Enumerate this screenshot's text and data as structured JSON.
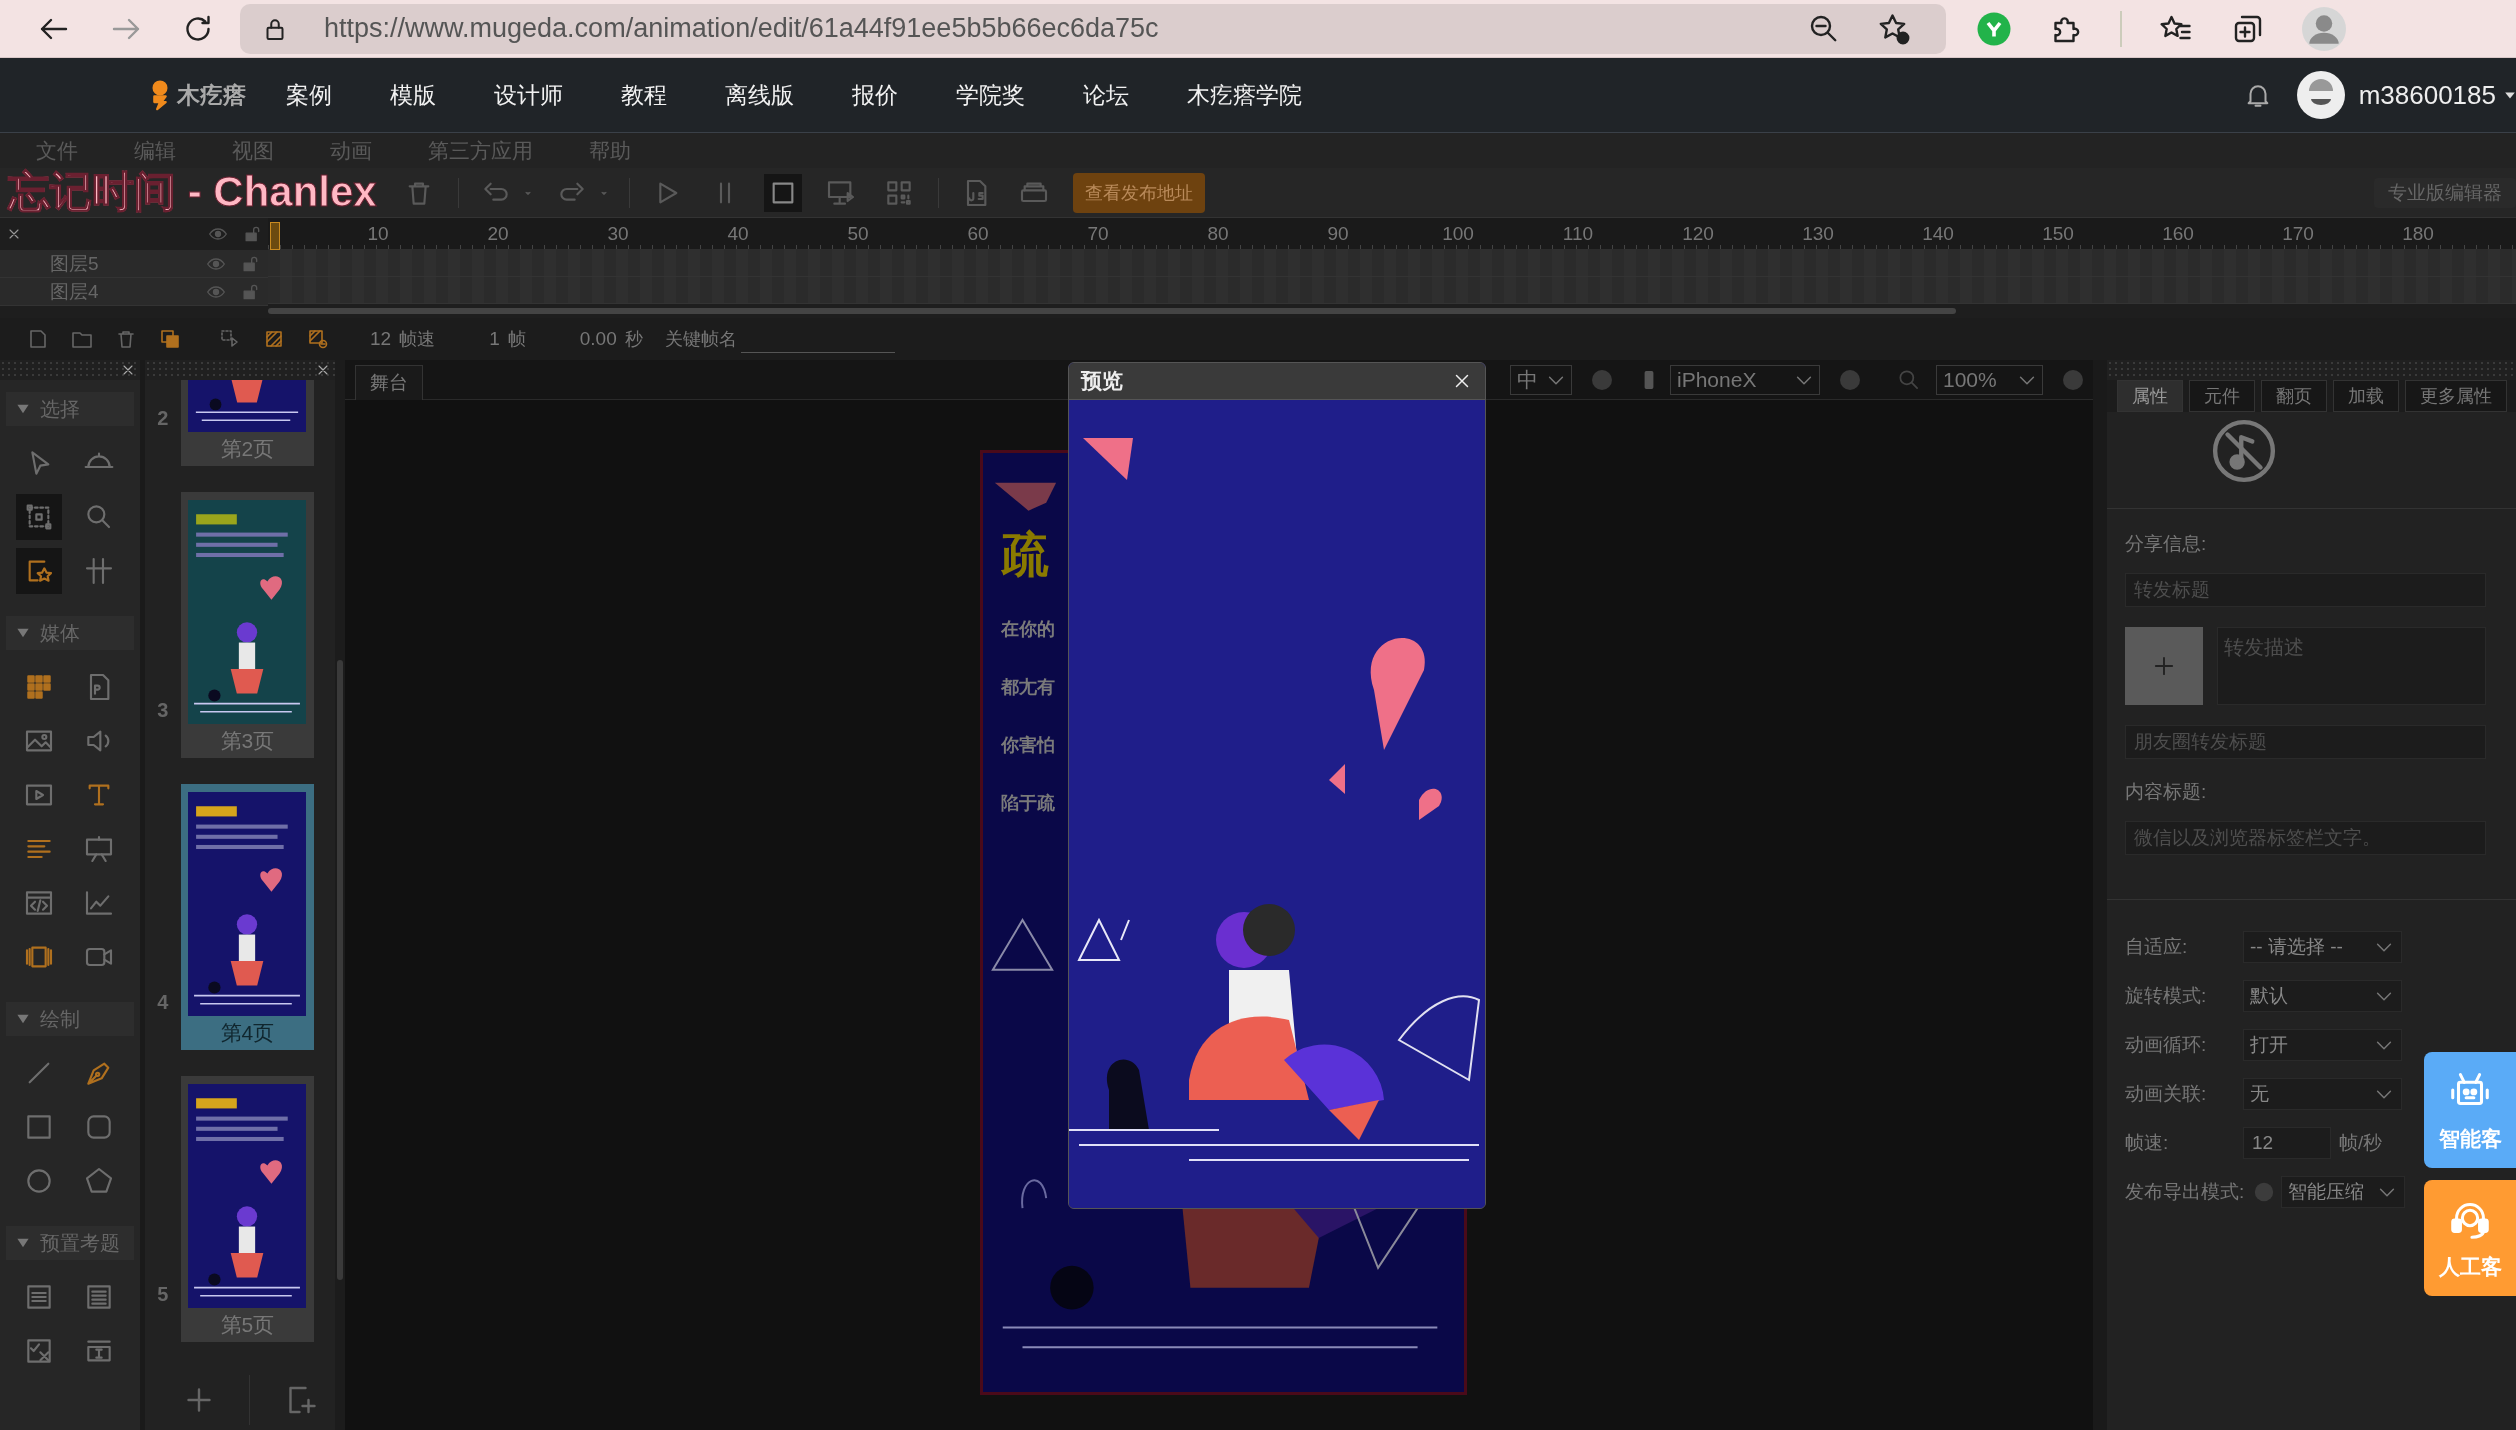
{
  "browser": {
    "url": "https://www.mugeda.com/animation/edit/61a44f91ee5b5b66ec6da75c"
  },
  "nav": {
    "logo": "木疙瘩",
    "items": [
      "案例",
      "模版",
      "设计师",
      "教程",
      "离线版",
      "报价",
      "学院奖",
      "论坛",
      "木疙瘩学院"
    ],
    "user": "m38600185"
  },
  "menu": [
    "文件",
    "编辑",
    "视图",
    "动画",
    "第三方应用",
    "帮助"
  ],
  "lyrics_overlay": "忘记时间 - Chanlex",
  "toolbar": {
    "publish_button": "查看发布地址",
    "pro_editor_button": "专业版编辑器"
  },
  "timeline": {
    "ticks": [
      "10",
      "20",
      "30",
      "40",
      "50",
      "60",
      "70",
      "80",
      "90",
      "100",
      "110",
      "120",
      "130",
      "140",
      "150",
      "160",
      "170",
      "180"
    ],
    "layers": [
      {
        "name": "图层5"
      },
      {
        "name": "图层4"
      }
    ],
    "fps": "12",
    "fps_label": "帧速",
    "frame": "1",
    "frame_label": "帧",
    "time": "0.00",
    "time_label": "秒",
    "keyframe_label": "关键帧名"
  },
  "tool_groups": [
    {
      "title": "选择",
      "expanded": true,
      "tools": [
        {
          "selected": false
        },
        {
          "selected": false
        },
        {
          "selected": true
        },
        {
          "selected": false
        },
        {
          "selected": true
        },
        {
          "selected": false
        }
      ]
    },
    {
      "title": "媒体",
      "expanded": true,
      "tools": [
        {
          "selected": false
        },
        {
          "selected": false
        },
        {
          "selected": false
        },
        {
          "selected": false
        },
        {
          "selected": false
        },
        {
          "selected": false
        },
        {
          "selected": false
        },
        {
          "selected": false
        },
        {
          "selected": false
        },
        {
          "selected": false
        },
        {
          "selected": false
        },
        {
          "selected": false
        }
      ]
    },
    {
      "title": "绘制",
      "expanded": true,
      "tools": [
        {
          "selected": false
        },
        {
          "selected": false
        },
        {
          "selected": false
        },
        {
          "selected": false
        },
        {
          "selected": false
        },
        {
          "selected": false
        }
      ]
    },
    {
      "title": "预置考题",
      "expanded": true,
      "tools": [
        {
          "selected": false
        },
        {
          "selected": false
        },
        {
          "selected": false
        },
        {
          "selected": false
        }
      ]
    }
  ],
  "pages": [
    {
      "number": "2",
      "label": "第2页",
      "selected": false
    },
    {
      "number": "3",
      "label": "第3页",
      "selected": false
    },
    {
      "number": "4",
      "label": "第4页",
      "selected": true
    },
    {
      "number": "5",
      "label": "第5页",
      "selected": false
    }
  ],
  "stage": {
    "tab": "舞台",
    "align": "中",
    "device": "iPhoneX",
    "zoom": "100%",
    "page": {
      "title": "疏",
      "lines": [
        "在你的",
        "都尢有",
        "你害怕",
        "陷于疏"
      ]
    }
  },
  "preview": {
    "title": "预览"
  },
  "properties": {
    "tabs": [
      {
        "label": "属性",
        "selected": true
      },
      {
        "label": "元件",
        "selected": false
      },
      {
        "label": "翻页",
        "selected": false
      },
      {
        "label": "加载",
        "selected": false
      },
      {
        "label": "更多属性",
        "selected": false
      }
    ],
    "share_label": "分享信息:",
    "share_title_placeholder": "转发标题",
    "share_desc_placeholder": "转发描述",
    "moments_title_placeholder": "朋友圈转发标题",
    "content_label": "内容标题:",
    "content_placeholder": "微信以及浏览器标签栏文字。",
    "settings": [
      {
        "kind": "select",
        "label": "自适应:",
        "value": "-- 请选择 --"
      },
      {
        "kind": "select",
        "label": "旋转模式:",
        "value": "默认"
      },
      {
        "kind": "select",
        "label": "动画循环:",
        "value": "打开"
      },
      {
        "kind": "select",
        "label": "动画关联:",
        "value": "无"
      },
      {
        "kind": "input",
        "label": "帧速:",
        "value": "12",
        "unit": "帧/秒"
      },
      {
        "kind": "help-select",
        "label": "发布导出模式:",
        "value": "智能压缩"
      }
    ]
  },
  "support": [
    {
      "label": "智能客",
      "color": "#5aabf7"
    },
    {
      "label": "人工客",
      "color": "#ff9b32"
    }
  ]
}
